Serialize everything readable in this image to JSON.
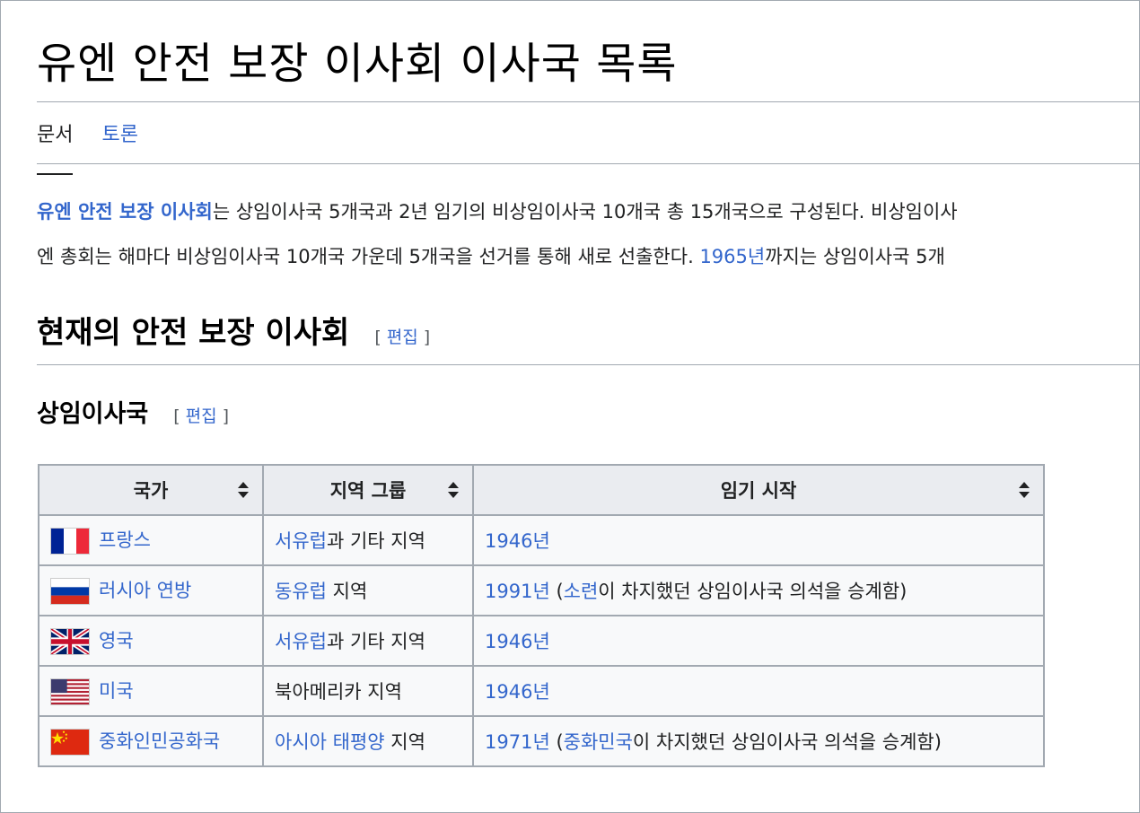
{
  "page": {
    "title": "유엔 안전 보장 이사회 이사국 목록",
    "tabs": [
      {
        "label": "문서",
        "selected": true
      },
      {
        "label": "토론",
        "selected": false
      }
    ]
  },
  "intro": {
    "line1": {
      "link": "유엔 안전 보장 이사회",
      "text": "는 상임이사국 5개국과 2년 임기의 비상임이사국 10개국 총 15개국으로 구성된다. 비상임이사"
    },
    "line2": {
      "text_before": "엔 총회는 해마다 비상임이사국 10개국 가운데 5개국을 선거를 통해 새로 선출한다. ",
      "link": "1965년",
      "text_after": "까지는 상임이사국 5개"
    }
  },
  "sections": {
    "current": {
      "heading": "현재의 안전 보장 이사회",
      "edit_label": "편집"
    },
    "permanent": {
      "heading": "상임이사국",
      "edit_label": "편집"
    }
  },
  "table": {
    "headers": [
      "국가",
      "지역 그룹",
      "임기 시작"
    ],
    "rows": [
      {
        "flag": "france-flag-icon",
        "country": "프랑스",
        "region_link": "서유럽",
        "region_text": "과 기타 지역",
        "start_link": "1946년",
        "note_before": "",
        "note_link": "",
        "note_after": ""
      },
      {
        "flag": "russia-flag-icon",
        "country": "러시아 연방",
        "region_link": "동유럽",
        "region_text": " 지역",
        "start_link": "1991년",
        "note_before": " (",
        "note_link": "소련",
        "note_after": "이 차지했던 상임이사국 의석을 승계함)"
      },
      {
        "flag": "uk-flag-icon",
        "country": "영국",
        "region_link": "서유럽",
        "region_text": "과 기타 지역",
        "start_link": "1946년",
        "note_before": "",
        "note_link": "",
        "note_after": ""
      },
      {
        "flag": "usa-flag-icon",
        "country": "미국",
        "region_link": "",
        "region_text": "북아메리카 지역",
        "start_link": "1946년",
        "note_before": "",
        "note_link": "",
        "note_after": ""
      },
      {
        "flag": "china-flag-icon",
        "country": "중화인민공화국",
        "region_link": "아시아 태평양",
        "region_text": " 지역",
        "start_link": "1971년",
        "note_before": " (",
        "note_link": "중화민국",
        "note_after": "이 차지했던 상임이사국 의석을 승계함)"
      }
    ]
  },
  "colors": {
    "link": "#3366cc",
    "header_bg": "#eaecf0",
    "cell_bg": "#f8f9fa",
    "border": "#a2a9b1"
  }
}
